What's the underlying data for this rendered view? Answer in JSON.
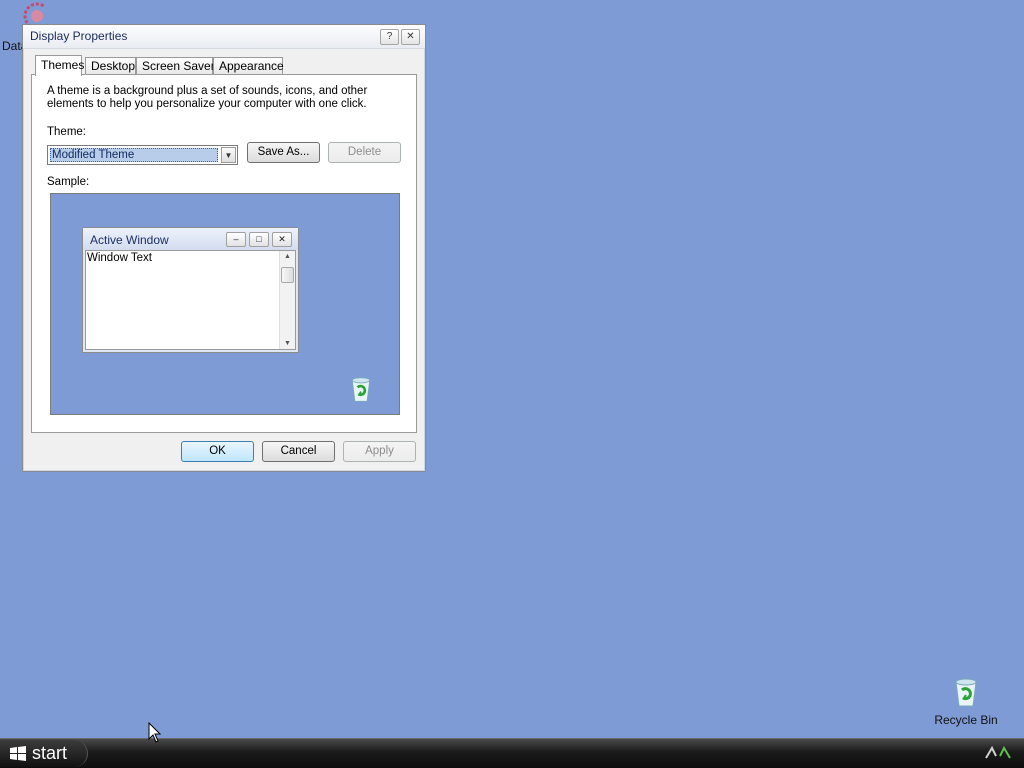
{
  "dialog": {
    "title": "Display Properties",
    "help_glyph": "?",
    "close_glyph": "✕",
    "tabs": [
      {
        "label": "Themes",
        "active": true
      },
      {
        "label": "Desktop",
        "active": false
      },
      {
        "label": "Screen Saver",
        "active": false
      },
      {
        "label": "Appearance",
        "active": false
      }
    ],
    "description": "A theme is a background plus a set of sounds, icons, and other elements to help you personalize your computer with one click.",
    "theme_label": "Theme:",
    "theme_value": "Modified Theme",
    "save_as_label": "Save As...",
    "delete_label": "Delete",
    "sample_label": "Sample:",
    "sample": {
      "window_title": "Active Window",
      "window_text": "Window Text",
      "minimize_glyph": "–",
      "maximize_glyph": "□",
      "close_glyph": "✕",
      "scroll_up_glyph": "▲",
      "scroll_down_glyph": "▼"
    },
    "ok_label": "OK",
    "cancel_label": "Cancel",
    "apply_label": "Apply"
  },
  "desktop": {
    "icons": [
      {
        "label": "Data",
        "icon": "data-icon"
      },
      {
        "label": "Recycle Bin",
        "icon": "recycle-bin-icon"
      }
    ]
  },
  "taskbar": {
    "start_label": "start"
  },
  "colors": {
    "desktop": "#7f9bd5",
    "taskbar": "#1a1a1a",
    "dialog": "#f0f0f0"
  }
}
